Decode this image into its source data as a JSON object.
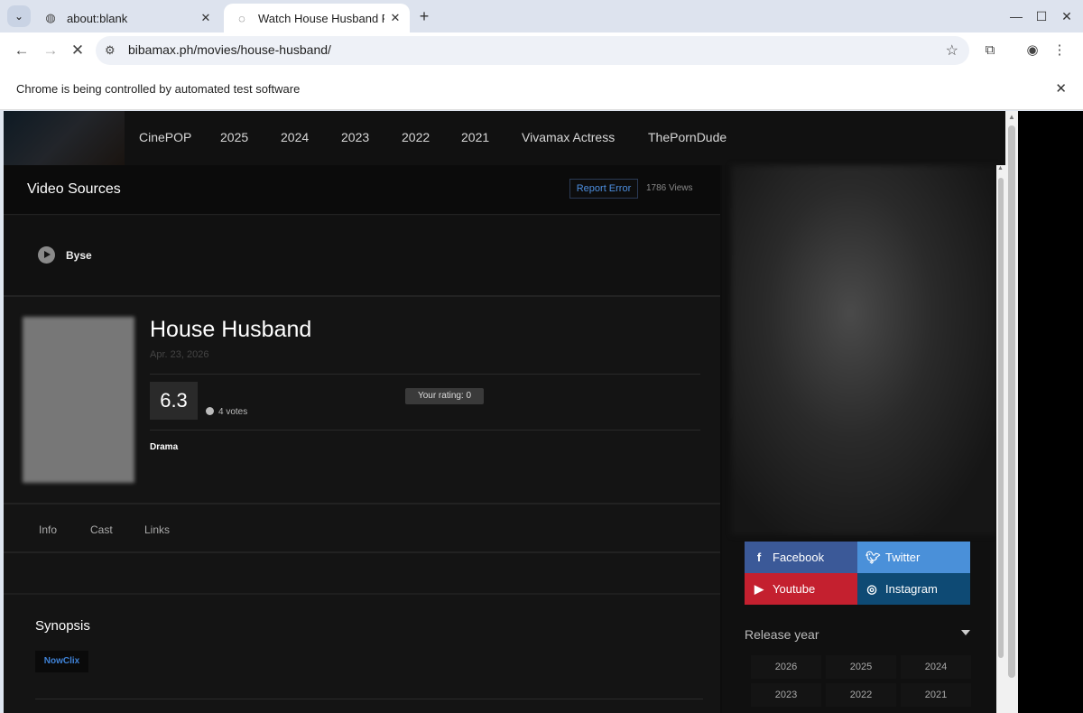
{
  "browser": {
    "tabs": [
      {
        "title": "about:blank"
      },
      {
        "title": "Watch House Husband FULL"
      }
    ],
    "url": "bibamax.ph/movies/house-husband/",
    "infobar": "Chrome is being controlled by automated test software"
  },
  "site": {
    "nav": [
      "CinePOP",
      "2025",
      "2024",
      "2023",
      "2022",
      "2021",
      "Vivamax Actress",
      "ThePornDude"
    ]
  },
  "sources": {
    "title": "Video Sources",
    "report_label": "Report Error",
    "views": "1786 Views",
    "server": "Byse"
  },
  "movie": {
    "title": "House Husband",
    "date": "Apr. 23, 2026",
    "score": "6.3",
    "votes": "4 votes",
    "your_rating": "Your rating: 0",
    "genre": "Drama"
  },
  "tabs": [
    "Info",
    "Cast",
    "Links"
  ],
  "synopsis": {
    "title": "Synopsis",
    "tag": "NowClix"
  },
  "social": [
    {
      "label": "Facebook",
      "icon": "facebook-icon",
      "color": "#3b5998"
    },
    {
      "label": "Twitter",
      "icon": "twitter-icon",
      "color": "#4a90d9"
    },
    {
      "label": "Youtube",
      "icon": "youtube-icon",
      "color": "#c4202f"
    },
    {
      "label": "Instagram",
      "icon": "instagram-icon",
      "color": "#0e4a74"
    }
  ],
  "release_year": {
    "label": "Release year",
    "years": [
      "2026",
      "2025",
      "2024",
      "2023",
      "2022",
      "2021"
    ]
  }
}
